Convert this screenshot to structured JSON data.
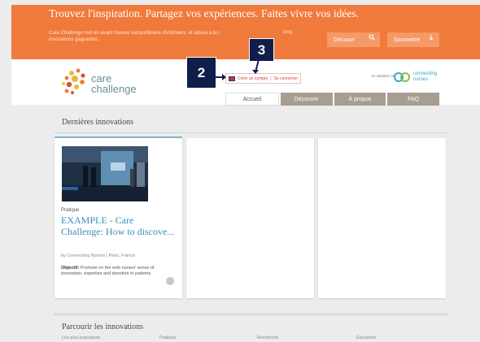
{
  "header": {
    "tagline": "Trouvez l'inspiration. Partagez vos expériences. Faites vivre vos idées.",
    "intro": "Care Challenge met en avant l'œuvre extraordinaire d'infirmiers, et aidera à la r",
    "intro_line2": "innovations gagnantes.",
    "intro_tail": "ving",
    "discover_button": "Découvr",
    "discover_icon": "search-icon",
    "submit_button": "Soumettre",
    "submit_icon": "arrow-down-icon"
  },
  "brand": {
    "logo_line1": "care",
    "logo_line2": "challenge",
    "initiative": "An initiative of",
    "partner_line1": "connecting",
    "partner_line2": "nurses"
  },
  "account": {
    "create": "Créer un compte",
    "separator": "|",
    "login": "Se connecter"
  },
  "nav": {
    "tabs": [
      "Accueil",
      "Découvrir",
      "À propos",
      "FAQ"
    ],
    "active": "Accueil"
  },
  "annotations": {
    "a2": "2",
    "a3": "3"
  },
  "main": {
    "section_title": "Dernières innovations",
    "card": {
      "category": "Pratique",
      "title": "EXAMPLE - Care Challenge: How to discove...",
      "meta": "by Connecting Nurses | Paris, France",
      "objective_label": "Objectif:",
      "objective_text": "Promote on the web nurses' sense of innovation, expertize and devotion to patients"
    },
    "browse_title": "Parcourir les innovations",
    "browse_columns": [
      "Les plus populaires",
      "Pratique",
      "Recherche",
      "Éducation"
    ]
  },
  "colors": {
    "orange": "#f07a3c",
    "link_blue": "#3a8bb8",
    "annotation": "#0f1e4a"
  }
}
